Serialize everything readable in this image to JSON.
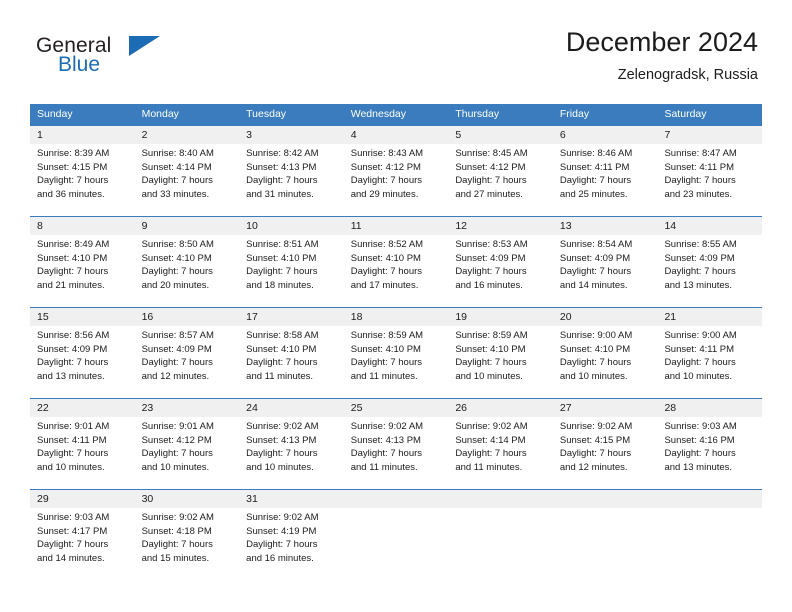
{
  "brand": {
    "name_line1": "General",
    "name_line2": "Blue",
    "flag_icon": "triangle-flag-icon"
  },
  "header": {
    "title": "December 2024",
    "subtitle": "Zelenogradsk, Russia"
  },
  "colors": {
    "header_blue": "#3a7cbe",
    "brand_blue": "#1b6cb5",
    "daynum_band": "#f0f0f0",
    "text": "#1c1c1c"
  },
  "weekdays": [
    "Sunday",
    "Monday",
    "Tuesday",
    "Wednesday",
    "Thursday",
    "Friday",
    "Saturday"
  ],
  "weeks": [
    [
      {
        "day": "1",
        "sunrise": "Sunrise: 8:39 AM",
        "sunset": "Sunset: 4:15 PM",
        "daylight1": "Daylight: 7 hours",
        "daylight2": "and 36 minutes."
      },
      {
        "day": "2",
        "sunrise": "Sunrise: 8:40 AM",
        "sunset": "Sunset: 4:14 PM",
        "daylight1": "Daylight: 7 hours",
        "daylight2": "and 33 minutes."
      },
      {
        "day": "3",
        "sunrise": "Sunrise: 8:42 AM",
        "sunset": "Sunset: 4:13 PM",
        "daylight1": "Daylight: 7 hours",
        "daylight2": "and 31 minutes."
      },
      {
        "day": "4",
        "sunrise": "Sunrise: 8:43 AM",
        "sunset": "Sunset: 4:12 PM",
        "daylight1": "Daylight: 7 hours",
        "daylight2": "and 29 minutes."
      },
      {
        "day": "5",
        "sunrise": "Sunrise: 8:45 AM",
        "sunset": "Sunset: 4:12 PM",
        "daylight1": "Daylight: 7 hours",
        "daylight2": "and 27 minutes."
      },
      {
        "day": "6",
        "sunrise": "Sunrise: 8:46 AM",
        "sunset": "Sunset: 4:11 PM",
        "daylight1": "Daylight: 7 hours",
        "daylight2": "and 25 minutes."
      },
      {
        "day": "7",
        "sunrise": "Sunrise: 8:47 AM",
        "sunset": "Sunset: 4:11 PM",
        "daylight1": "Daylight: 7 hours",
        "daylight2": "and 23 minutes."
      }
    ],
    [
      {
        "day": "8",
        "sunrise": "Sunrise: 8:49 AM",
        "sunset": "Sunset: 4:10 PM",
        "daylight1": "Daylight: 7 hours",
        "daylight2": "and 21 minutes."
      },
      {
        "day": "9",
        "sunrise": "Sunrise: 8:50 AM",
        "sunset": "Sunset: 4:10 PM",
        "daylight1": "Daylight: 7 hours",
        "daylight2": "and 20 minutes."
      },
      {
        "day": "10",
        "sunrise": "Sunrise: 8:51 AM",
        "sunset": "Sunset: 4:10 PM",
        "daylight1": "Daylight: 7 hours",
        "daylight2": "and 18 minutes."
      },
      {
        "day": "11",
        "sunrise": "Sunrise: 8:52 AM",
        "sunset": "Sunset: 4:10 PM",
        "daylight1": "Daylight: 7 hours",
        "daylight2": "and 17 minutes."
      },
      {
        "day": "12",
        "sunrise": "Sunrise: 8:53 AM",
        "sunset": "Sunset: 4:09 PM",
        "daylight1": "Daylight: 7 hours",
        "daylight2": "and 16 minutes."
      },
      {
        "day": "13",
        "sunrise": "Sunrise: 8:54 AM",
        "sunset": "Sunset: 4:09 PM",
        "daylight1": "Daylight: 7 hours",
        "daylight2": "and 14 minutes."
      },
      {
        "day": "14",
        "sunrise": "Sunrise: 8:55 AM",
        "sunset": "Sunset: 4:09 PM",
        "daylight1": "Daylight: 7 hours",
        "daylight2": "and 13 minutes."
      }
    ],
    [
      {
        "day": "15",
        "sunrise": "Sunrise: 8:56 AM",
        "sunset": "Sunset: 4:09 PM",
        "daylight1": "Daylight: 7 hours",
        "daylight2": "and 13 minutes."
      },
      {
        "day": "16",
        "sunrise": "Sunrise: 8:57 AM",
        "sunset": "Sunset: 4:09 PM",
        "daylight1": "Daylight: 7 hours",
        "daylight2": "and 12 minutes."
      },
      {
        "day": "17",
        "sunrise": "Sunrise: 8:58 AM",
        "sunset": "Sunset: 4:10 PM",
        "daylight1": "Daylight: 7 hours",
        "daylight2": "and 11 minutes."
      },
      {
        "day": "18",
        "sunrise": "Sunrise: 8:59 AM",
        "sunset": "Sunset: 4:10 PM",
        "daylight1": "Daylight: 7 hours",
        "daylight2": "and 11 minutes."
      },
      {
        "day": "19",
        "sunrise": "Sunrise: 8:59 AM",
        "sunset": "Sunset: 4:10 PM",
        "daylight1": "Daylight: 7 hours",
        "daylight2": "and 10 minutes."
      },
      {
        "day": "20",
        "sunrise": "Sunrise: 9:00 AM",
        "sunset": "Sunset: 4:10 PM",
        "daylight1": "Daylight: 7 hours",
        "daylight2": "and 10 minutes."
      },
      {
        "day": "21",
        "sunrise": "Sunrise: 9:00 AM",
        "sunset": "Sunset: 4:11 PM",
        "daylight1": "Daylight: 7 hours",
        "daylight2": "and 10 minutes."
      }
    ],
    [
      {
        "day": "22",
        "sunrise": "Sunrise: 9:01 AM",
        "sunset": "Sunset: 4:11 PM",
        "daylight1": "Daylight: 7 hours",
        "daylight2": "and 10 minutes."
      },
      {
        "day": "23",
        "sunrise": "Sunrise: 9:01 AM",
        "sunset": "Sunset: 4:12 PM",
        "daylight1": "Daylight: 7 hours",
        "daylight2": "and 10 minutes."
      },
      {
        "day": "24",
        "sunrise": "Sunrise: 9:02 AM",
        "sunset": "Sunset: 4:13 PM",
        "daylight1": "Daylight: 7 hours",
        "daylight2": "and 10 minutes."
      },
      {
        "day": "25",
        "sunrise": "Sunrise: 9:02 AM",
        "sunset": "Sunset: 4:13 PM",
        "daylight1": "Daylight: 7 hours",
        "daylight2": "and 11 minutes."
      },
      {
        "day": "26",
        "sunrise": "Sunrise: 9:02 AM",
        "sunset": "Sunset: 4:14 PM",
        "daylight1": "Daylight: 7 hours",
        "daylight2": "and 11 minutes."
      },
      {
        "day": "27",
        "sunrise": "Sunrise: 9:02 AM",
        "sunset": "Sunset: 4:15 PM",
        "daylight1": "Daylight: 7 hours",
        "daylight2": "and 12 minutes."
      },
      {
        "day": "28",
        "sunrise": "Sunrise: 9:03 AM",
        "sunset": "Sunset: 4:16 PM",
        "daylight1": "Daylight: 7 hours",
        "daylight2": "and 13 minutes."
      }
    ],
    [
      {
        "day": "29",
        "sunrise": "Sunrise: 9:03 AM",
        "sunset": "Sunset: 4:17 PM",
        "daylight1": "Daylight: 7 hours",
        "daylight2": "and 14 minutes."
      },
      {
        "day": "30",
        "sunrise": "Sunrise: 9:02 AM",
        "sunset": "Sunset: 4:18 PM",
        "daylight1": "Daylight: 7 hours",
        "daylight2": "and 15 minutes."
      },
      {
        "day": "31",
        "sunrise": "Sunrise: 9:02 AM",
        "sunset": "Sunset: 4:19 PM",
        "daylight1": "Daylight: 7 hours",
        "daylight2": "and 16 minutes."
      },
      {
        "day": "",
        "sunrise": "",
        "sunset": "",
        "daylight1": "",
        "daylight2": ""
      },
      {
        "day": "",
        "sunrise": "",
        "sunset": "",
        "daylight1": "",
        "daylight2": ""
      },
      {
        "day": "",
        "sunrise": "",
        "sunset": "",
        "daylight1": "",
        "daylight2": ""
      },
      {
        "day": "",
        "sunrise": "",
        "sunset": "",
        "daylight1": "",
        "daylight2": ""
      }
    ]
  ]
}
